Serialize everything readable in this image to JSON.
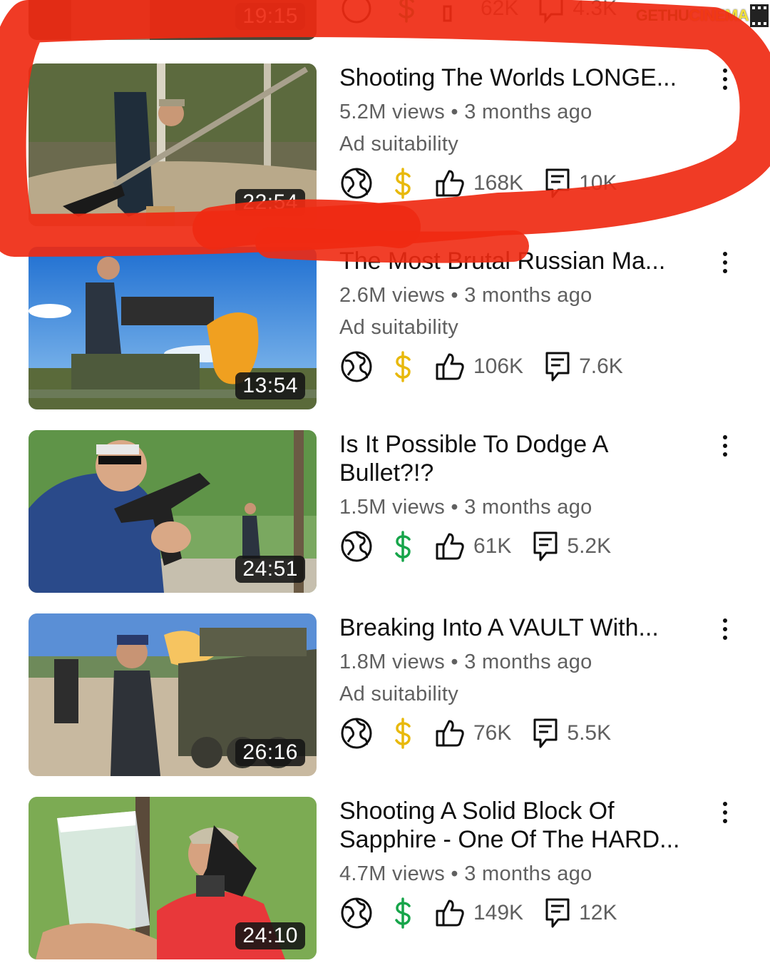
{
  "watermark": {
    "part1": "GETHU",
    "part2": "CINEMA"
  },
  "top_partial": {
    "duration": "19:15",
    "likes": "62K",
    "comments": "4.3K"
  },
  "videos": [
    {
      "title": "Shooting The Worlds LONGE...",
      "views": "5.2M views",
      "age": "3 months ago",
      "ad": "Ad suitability",
      "duration": "22:54",
      "likes": "168K",
      "comments": "10K",
      "monetization": "yellow"
    },
    {
      "title": "The Most Brutal Russian Ma...",
      "views": "2.6M views",
      "age": "3 months ago",
      "ad": "Ad suitability",
      "duration": "13:54",
      "likes": "106K",
      "comments": "7.6K",
      "monetization": "yellow"
    },
    {
      "title": "Is It Possible To Dodge A Bullet?!?",
      "views": "1.5M views",
      "age": "3 months ago",
      "duration": "24:51",
      "likes": "61K",
      "comments": "5.2K",
      "monetization": "green"
    },
    {
      "title": "Breaking Into A VAULT With...",
      "views": "1.8M views",
      "age": "3 months ago",
      "ad": "Ad suitability",
      "duration": "26:16",
      "likes": "76K",
      "comments": "5.5K",
      "monetization": "yellow"
    },
    {
      "title": "Shooting A Solid Block Of Sapphire - One Of The HARD...",
      "views": "4.7M views",
      "age": "3 months ago",
      "duration": "24:10",
      "likes": "149K",
      "comments": "12K",
      "monetization": "green"
    }
  ],
  "colors": {
    "annotation": "#ef2a12",
    "money_yellow": "#e8b90c",
    "money_green": "#17a54a",
    "meta": "#606060"
  },
  "icons": [
    "globe-icon",
    "dollar-icon",
    "thumbs-up-icon",
    "comment-icon",
    "more-vert-icon"
  ]
}
